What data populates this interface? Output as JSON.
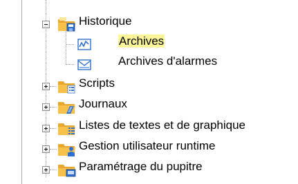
{
  "tree": {
    "nodes": [
      {
        "label": "Historique",
        "state": "expanded",
        "icon": "history-folder-icon"
      },
      {
        "label": "Archives",
        "state": "leaf",
        "icon": "archive-chart-icon",
        "highlighted": true
      },
      {
        "label": "Archives d'alarmes",
        "state": "leaf",
        "icon": "alarm-archive-icon"
      },
      {
        "label": "Scripts",
        "state": "collapsed",
        "icon": "scripts-folder-icon"
      },
      {
        "label": "Journaux",
        "state": "collapsed",
        "icon": "logs-folder-icon"
      },
      {
        "label": "Listes de textes et de graphique",
        "state": "collapsed",
        "icon": "text-graphic-lists-folder-icon"
      },
      {
        "label": "Gestion utilisateur runtime",
        "state": "collapsed",
        "icon": "user-management-folder-icon"
      },
      {
        "label": "Paramétrage du pupitre",
        "state": "collapsed",
        "icon": "panel-settings-folder-icon"
      }
    ]
  },
  "colors": {
    "highlight": "#fbf59a",
    "folder": "#f6c04a",
    "blue": "#2f6fcf"
  }
}
